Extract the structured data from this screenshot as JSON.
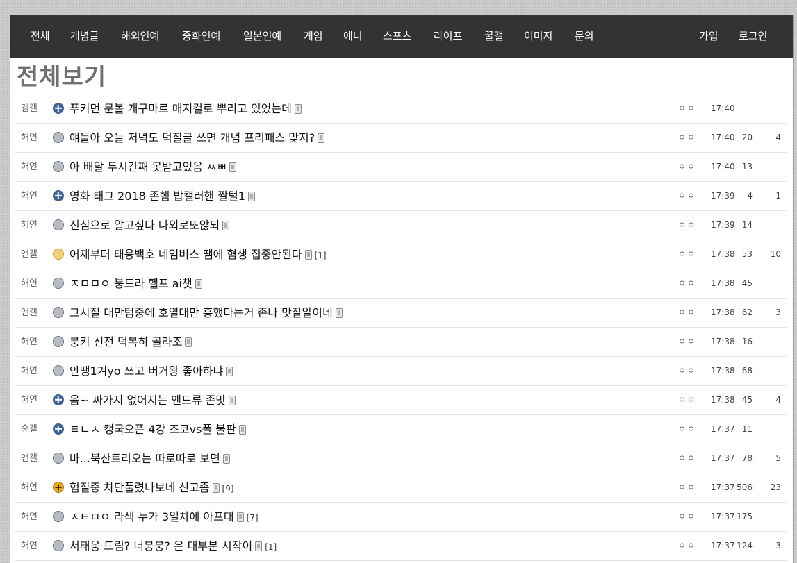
{
  "nav": {
    "left": [
      "전체",
      "개념글",
      "해외연예",
      "중화연예",
      "일본연예",
      "게임",
      "애니",
      "스포츠",
      "라이프",
      "꿀갤",
      "이미지",
      "문의"
    ],
    "right": [
      "가입",
      "로그인"
    ]
  },
  "page_title": "전체보기",
  "posts": [
    {
      "cat": "겜갤",
      "icon": "plus-icon",
      "title": "푸키먼 문볼 개구마르 매지컬로 뿌리고 있었는데",
      "comments": "",
      "author": "ㅇㅇ",
      "time": "17:40",
      "views": "",
      "recs": ""
    },
    {
      "cat": "해연",
      "icon": "gray-circle-icon",
      "title": "얘들아 오늘 저녁도 덕질글 쓰면 개념 프리패스 맞지?",
      "comments": "",
      "author": "ㅇㅇ",
      "time": "17:40",
      "views": "20",
      "recs": "4"
    },
    {
      "cat": "해연",
      "icon": "gray-circle-icon",
      "title": "아 배달 두시간째 못받고있음 ㅆㅃ",
      "comments": "",
      "author": "ㅇㅇ",
      "time": "17:40",
      "views": "13",
      "recs": ""
    },
    {
      "cat": "해연",
      "icon": "plus-icon",
      "title": "영화 태그 2018 존햄 밥캘러핸 짤털1",
      "comments": "",
      "author": "ㅇㅇ",
      "time": "17:39",
      "views": "4",
      "recs": "1"
    },
    {
      "cat": "해연",
      "icon": "gray-circle-icon",
      "title": "진심으로 알고싶다 나외로또않되",
      "comments": "",
      "author": "ㅇㅇ",
      "time": "17:39",
      "views": "14",
      "recs": ""
    },
    {
      "cat": "앤갤",
      "icon": "yellow-circle-icon",
      "title": "어제부터 태웅백호 네임버스 땜에 혐생 집중안된다",
      "comments": "[1]",
      "author": "ㅇㅇ",
      "time": "17:38",
      "views": "53",
      "recs": "10"
    },
    {
      "cat": "해연",
      "icon": "gray-circle-icon",
      "title": "ㅈㅁㅁㅇ 붕드라 헬프 ai챗",
      "comments": "",
      "author": "ㅇㅇ",
      "time": "17:38",
      "views": "45",
      "recs": ""
    },
    {
      "cat": "앤갤",
      "icon": "gray-circle-icon",
      "title": "그시절 대만텀중에 호열대만 흥했다는거 존나 맛잘알이네",
      "comments": "",
      "author": "ㅇㅇ",
      "time": "17:38",
      "views": "62",
      "recs": "3"
    },
    {
      "cat": "해연",
      "icon": "gray-circle-icon",
      "title": "붕키 신전 덕복히 골라조",
      "comments": "",
      "author": "ㅇㅇ",
      "time": "17:38",
      "views": "16",
      "recs": ""
    },
    {
      "cat": "해연",
      "icon": "gray-circle-icon",
      "title": "안땡1겨yo 쓰고 버거왕 좋아하냐",
      "comments": "",
      "author": "ㅇㅇ",
      "time": "17:38",
      "views": "68",
      "recs": ""
    },
    {
      "cat": "해연",
      "icon": "plus-icon",
      "title": "음~ 싸가지 없어지는 앤드류 존맛",
      "comments": "",
      "author": "ㅇㅇ",
      "time": "17:38",
      "views": "45",
      "recs": "4"
    },
    {
      "cat": "숲갤",
      "icon": "plus-icon",
      "title": "ㅌㄴㅅ 캥국오픈 4강 조코vs폴 불판",
      "comments": "",
      "author": "ㅇㅇ",
      "time": "17:37",
      "views": "11",
      "recs": ""
    },
    {
      "cat": "앤갤",
      "icon": "gray-circle-icon",
      "title": "바...북산트리오는 따로따로 보면",
      "comments": "",
      "author": "ㅇㅇ",
      "time": "17:37",
      "views": "78",
      "recs": "5"
    },
    {
      "cat": "해연",
      "icon": "gold-plus-icon",
      "title": "혐질중 차단풀렸나보네 신고좀",
      "comments": "[9]",
      "author": "ㅇㅇ",
      "time": "17:37",
      "views": "506",
      "recs": "23"
    },
    {
      "cat": "해연",
      "icon": "gray-circle-icon",
      "title": "ㅅㅌㅁㅇ 라섹 누가 3일차에 아프대",
      "comments": "[7]",
      "author": "ㅇㅇ",
      "time": "17:37",
      "views": "175",
      "recs": ""
    },
    {
      "cat": "해연",
      "icon": "gray-circle-icon",
      "title": "서태웅 드림? 너붕붕? 은 대부분 시작이",
      "comments": "[1]",
      "author": "ㅇㅇ",
      "time": "17:37",
      "views": "124",
      "recs": "3"
    }
  ]
}
